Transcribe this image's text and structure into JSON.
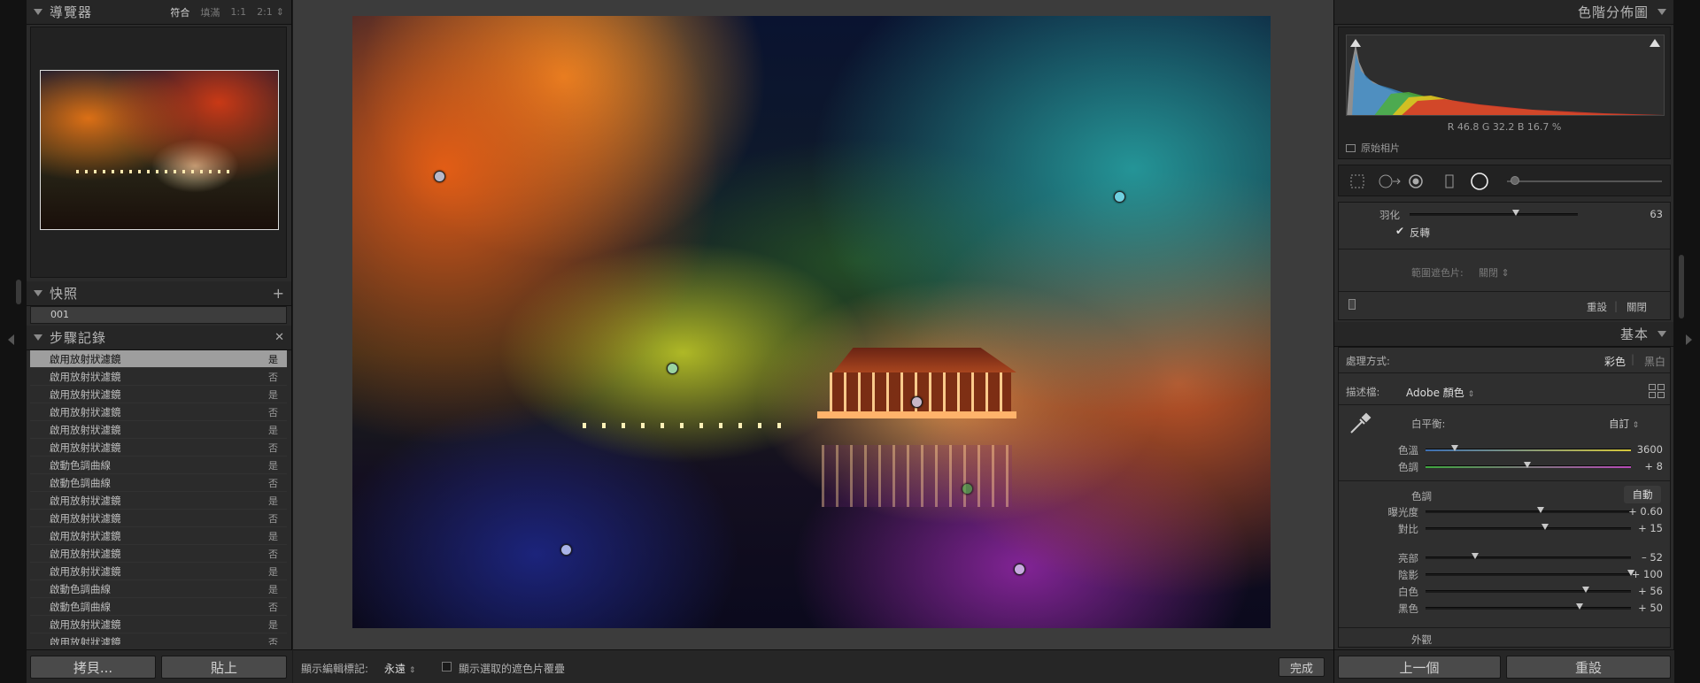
{
  "navigator": {
    "title": "導覽器",
    "zoom_options": [
      "符合",
      "填滿",
      "1:1",
      "2:1"
    ],
    "zoom_selected": "符合"
  },
  "snapshots": {
    "title": "快照",
    "items": [
      "001"
    ]
  },
  "history": {
    "title": "步驟記錄",
    "rows": [
      {
        "name": "啟用放射狀濾鏡",
        "flag": "是",
        "selected": true
      },
      {
        "name": "啟用放射狀濾鏡",
        "flag": "否"
      },
      {
        "name": "啟用放射狀濾鏡",
        "flag": "是"
      },
      {
        "name": "啟用放射狀濾鏡",
        "flag": "否"
      },
      {
        "name": "啟用放射狀濾鏡",
        "flag": "是"
      },
      {
        "name": "啟用放射狀濾鏡",
        "flag": "否"
      },
      {
        "name": "啟動色調曲線",
        "flag": "是"
      },
      {
        "name": "啟動色調曲線",
        "flag": "否"
      },
      {
        "name": "啟用放射狀濾鏡",
        "flag": "是"
      },
      {
        "name": "啟用放射狀濾鏡",
        "flag": "否"
      },
      {
        "name": "啟用放射狀濾鏡",
        "flag": "是"
      },
      {
        "name": "啟用放射狀濾鏡",
        "flag": "否"
      },
      {
        "name": "啟用放射狀濾鏡",
        "flag": "是"
      },
      {
        "name": "啟動色調曲線",
        "flag": "是"
      },
      {
        "name": "啟動色調曲線",
        "flag": "否"
      },
      {
        "name": "啟用放射狀濾鏡",
        "flag": "是"
      },
      {
        "name": "啟用放射狀濾鏡",
        "flag": "否"
      }
    ]
  },
  "left_buttons": {
    "copy": "拷貝...",
    "paste": "貼上"
  },
  "toolbar": {
    "show_edit_pins_label": "顯示編輯標記:",
    "show_edit_pins_value": "永遠",
    "show_overlay_label": "顯示選取的遮色片覆疊",
    "done": "完成"
  },
  "histogram": {
    "title": "色階分佈圖",
    "readout": "R  46.8   G  32.2   B  16.7  %",
    "original_photo": "原始相片"
  },
  "mask": {
    "feather_label": "羽化",
    "feather_value": "63",
    "feather_level": 0.63,
    "invert_label": "反轉",
    "range_mask_label": "範圍遮色片:",
    "range_mask_value": "關閉",
    "reset": "重設",
    "close": "關閉"
  },
  "basic": {
    "title": "基本",
    "treatment_label": "處理方式:",
    "color": "彩色",
    "bw": "黑白",
    "profile_label": "描述檔:",
    "profile_value": "Adobe 顏色",
    "wb_label": "白平衡:",
    "wb_value": "自訂",
    "temp_label": "色溫",
    "temp_value": "3600",
    "tint_label": "色調",
    "tint_value": "+ 8",
    "tone_label": "色調",
    "auto": "自動",
    "exposure_label": "曝光度",
    "exposure_value": "+ 0.60",
    "contrast_label": "對比",
    "contrast_value": "+ 15",
    "highlights_label": "亮部",
    "highlights_value": "– 52",
    "shadows_label": "陰影",
    "shadows_value": "+ 100",
    "whites_label": "白色",
    "whites_value": "+ 56",
    "blacks_label": "黑色",
    "blacks_value": "+ 50",
    "presence_label": "外觀"
  },
  "right_buttons": {
    "previous": "上一個",
    "reset": "重設"
  },
  "colors": {
    "panel": "#2b2b2b",
    "center": "#3c3c3c",
    "accent_text": "#d8d8d8"
  }
}
